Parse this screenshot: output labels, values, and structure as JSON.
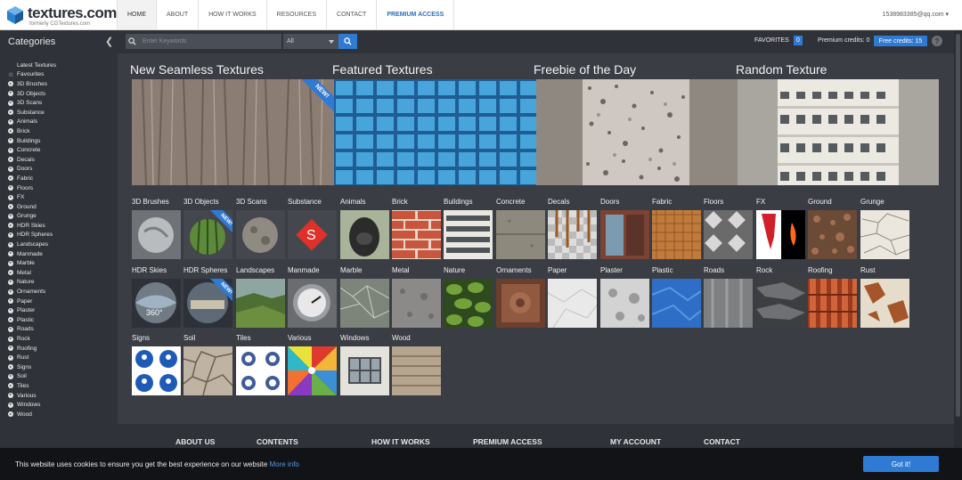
{
  "header": {
    "brand": "textures.com",
    "brand_sub": "formerly CGTextures.com",
    "nav": [
      "HOME",
      "ABOUT",
      "HOW IT WORKS",
      "RESOURCES",
      "CONTACT",
      "PREMIUM ACCESS"
    ],
    "account": "1538983385@qq.com ▾"
  },
  "sidebar": {
    "title": "Categories",
    "items": [
      {
        "label": "Latest Textures",
        "icon": "none"
      },
      {
        "label": "Favourites",
        "icon": "star-icon"
      },
      {
        "label": "3D Brushes",
        "icon": "arrow-circle-icon"
      },
      {
        "label": "3D Objects",
        "icon": "arrow-circle-icon"
      },
      {
        "label": "3D Scans",
        "icon": "arrow-circle-icon"
      },
      {
        "label": "Substance",
        "icon": "arrow-circle-icon"
      },
      {
        "label": "Animals",
        "icon": "arrow-circle-icon"
      },
      {
        "label": "Brick",
        "icon": "arrow-circle-icon"
      },
      {
        "label": "Buildings",
        "icon": "arrow-circle-icon"
      },
      {
        "label": "Concrete",
        "icon": "arrow-circle-icon"
      },
      {
        "label": "Decals",
        "icon": "arrow-circle-icon"
      },
      {
        "label": "Doors",
        "icon": "arrow-circle-icon"
      },
      {
        "label": "Fabric",
        "icon": "arrow-circle-icon"
      },
      {
        "label": "Floors",
        "icon": "arrow-circle-icon"
      },
      {
        "label": "FX",
        "icon": "arrow-circle-icon"
      },
      {
        "label": "Ground",
        "icon": "arrow-circle-icon"
      },
      {
        "label": "Grunge",
        "icon": "arrow-circle-icon"
      },
      {
        "label": "HDR Skies",
        "icon": "arrow-circle-icon"
      },
      {
        "label": "HDR Spheres",
        "icon": "arrow-circle-icon"
      },
      {
        "label": "Landscapes",
        "icon": "arrow-circle-icon"
      },
      {
        "label": "Manmade",
        "icon": "arrow-circle-icon"
      },
      {
        "label": "Marble",
        "icon": "arrow-circle-icon"
      },
      {
        "label": "Metal",
        "icon": "arrow-circle-icon"
      },
      {
        "label": "Nature",
        "icon": "arrow-circle-icon"
      },
      {
        "label": "Ornaments",
        "icon": "arrow-circle-icon"
      },
      {
        "label": "Paper",
        "icon": "arrow-circle-icon"
      },
      {
        "label": "Plaster",
        "icon": "arrow-circle-icon"
      },
      {
        "label": "Plastic",
        "icon": "arrow-circle-icon"
      },
      {
        "label": "Roads",
        "icon": "arrow-circle-icon"
      },
      {
        "label": "Rock",
        "icon": "arrow-circle-icon"
      },
      {
        "label": "Roofing",
        "icon": "arrow-circle-icon"
      },
      {
        "label": "Rust",
        "icon": "arrow-circle-icon"
      },
      {
        "label": "Signs",
        "icon": "arrow-circle-icon"
      },
      {
        "label": "Soil",
        "icon": "arrow-circle-icon"
      },
      {
        "label": "Tiles",
        "icon": "arrow-circle-icon"
      },
      {
        "label": "Various",
        "icon": "arrow-circle-icon"
      },
      {
        "label": "Windows",
        "icon": "arrow-circle-icon"
      },
      {
        "label": "Wood",
        "icon": "arrow-circle-icon"
      }
    ]
  },
  "search": {
    "placeholder": "Enter Keywords",
    "select_value": "All"
  },
  "status": {
    "favorites_label": "FAVORITES",
    "favorites_count": "0",
    "premium_credits": "Premium credits: 0",
    "free_credits": "Free credits: 15",
    "help": "?"
  },
  "featured": [
    {
      "title": "New Seamless Textures",
      "badge": "NEW!"
    },
    {
      "title": "Featured Textures",
      "badge": ""
    },
    {
      "title": "Freebie of the Day",
      "badge": ""
    },
    {
      "title": "Random Texture",
      "badge": ""
    }
  ],
  "grid": [
    {
      "label": "3D Brushes",
      "badge": ""
    },
    {
      "label": "3D Objects",
      "badge": "NEW!"
    },
    {
      "label": "3D Scans",
      "badge": ""
    },
    {
      "label": "Substance",
      "badge": ""
    },
    {
      "label": "Animals",
      "badge": ""
    },
    {
      "label": "Brick",
      "badge": ""
    },
    {
      "label": "Buildings",
      "badge": ""
    },
    {
      "label": "Concrete",
      "badge": ""
    },
    {
      "label": "Decals",
      "badge": ""
    },
    {
      "label": "Doors",
      "badge": ""
    },
    {
      "label": "Fabric",
      "badge": ""
    },
    {
      "label": "Floors",
      "badge": ""
    },
    {
      "label": "FX",
      "badge": ""
    },
    {
      "label": "Ground",
      "badge": ""
    },
    {
      "label": "Grunge",
      "badge": ""
    },
    {
      "label": "HDR Skies",
      "badge": "",
      "overlay": "360°"
    },
    {
      "label": "HDR Spheres",
      "badge": "NEW!"
    },
    {
      "label": "Landscapes",
      "badge": ""
    },
    {
      "label": "Manmade",
      "badge": ""
    },
    {
      "label": "Marble",
      "badge": ""
    },
    {
      "label": "Metal",
      "badge": ""
    },
    {
      "label": "Nature",
      "badge": ""
    },
    {
      "label": "Ornaments",
      "badge": ""
    },
    {
      "label": "Paper",
      "badge": ""
    },
    {
      "label": "Plaster",
      "badge": ""
    },
    {
      "label": "Plastic",
      "badge": ""
    },
    {
      "label": "Roads",
      "badge": ""
    },
    {
      "label": "Rock",
      "badge": ""
    },
    {
      "label": "Roofing",
      "badge": ""
    },
    {
      "label": "Rust",
      "badge": ""
    },
    {
      "label": "Signs",
      "badge": ""
    },
    {
      "label": "Soil",
      "badge": ""
    },
    {
      "label": "Tiles",
      "badge": ""
    },
    {
      "label": "Various",
      "badge": ""
    },
    {
      "label": "Windows",
      "badge": ""
    },
    {
      "label": "Wood",
      "badge": ""
    }
  ],
  "footer": [
    "ABOUT US",
    "CONTENTS",
    "HOW IT WORKS",
    "PREMIUM ACCESS",
    "MY ACCOUNT",
    "CONTACT"
  ],
  "cookie": {
    "text": "This website uses cookies to ensure you get the best experience on our website",
    "more": "More info",
    "button": "Got it!"
  },
  "colors": {
    "accent": "#2f7ad3",
    "page_bg": "#3a3d44",
    "panel_bg": "#2f3238",
    "cookie_bg": "#121316"
  }
}
